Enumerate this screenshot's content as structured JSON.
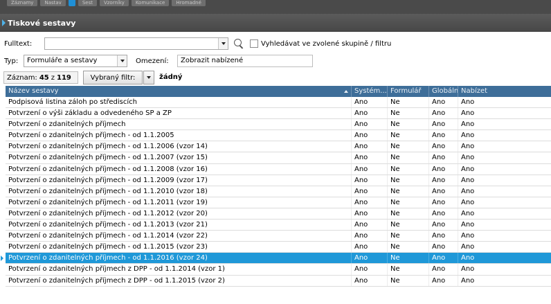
{
  "top_tabs": [
    "Záznamy",
    "Nastav",
    "",
    "Sest",
    "Vzorníky",
    "Komunikace",
    "Hromadné"
  ],
  "window": {
    "title": "Tiskové sestavy"
  },
  "search": {
    "fulltext_label": "Fulltext:",
    "fulltext_value": "",
    "scope_label": "Vyhledávat ve zvolené skupině / filtru"
  },
  "filters": {
    "type_label": "Typ:",
    "type_value": "Formuláře a sestavy",
    "limit_label": "Omezení:",
    "limit_value": "Zobrazit nabízené"
  },
  "status": {
    "records_label": "Záznam:",
    "current": "45",
    "of": "z",
    "total": "119",
    "filter_button": "Vybraný filtr:",
    "filter_value": "žádný"
  },
  "table": {
    "columns": [
      "Název sestavy",
      "Systém...",
      "Formulář",
      "Globální",
      "Nabízet"
    ],
    "rows": [
      [
        "Podpisová listina záloh po střediscích",
        "Ano",
        "Ne",
        "Ano",
        "Ano"
      ],
      [
        "Potvrzení o výši základu a odvedeného SP a ZP",
        "Ano",
        "Ne",
        "Ano",
        "Ano"
      ],
      [
        "Potvrzení o zdanitelných příjmech",
        "Ano",
        "Ne",
        "Ano",
        "Ano"
      ],
      [
        "Potvrzení o zdanitelných příjmech - od 1.1.2005",
        "Ano",
        "Ne",
        "Ano",
        "Ano"
      ],
      [
        "Potvrzení o zdanitelných příjmech - od 1.1.2006 (vzor 14)",
        "Ano",
        "Ne",
        "Ano",
        "Ano"
      ],
      [
        "Potvrzení o zdanitelných příjmech - od 1.1.2007 (vzor 15)",
        "Ano",
        "Ne",
        "Ano",
        "Ano"
      ],
      [
        "Potvrzení o zdanitelných příjmech - od 1.1.2008 (vzor 16)",
        "Ano",
        "Ne",
        "Ano",
        "Ano"
      ],
      [
        "Potvrzení o zdanitelných příjmech - od 1.1.2009 (vzor 17)",
        "Ano",
        "Ne",
        "Ano",
        "Ano"
      ],
      [
        "Potvrzení o zdanitelných příjmech - od 1.1.2010 (vzor 18)",
        "Ano",
        "Ne",
        "Ano",
        "Ano"
      ],
      [
        "Potvrzení o zdanitelných příjmech - od 1.1.2011 (vzor 19)",
        "Ano",
        "Ne",
        "Ano",
        "Ano"
      ],
      [
        "Potvrzení o zdanitelných příjmech - od 1.1.2012 (vzor 20)",
        "Ano",
        "Ne",
        "Ano",
        "Ano"
      ],
      [
        "Potvrzení o zdanitelných příjmech - od 1.1.2013 (vzor 21)",
        "Ano",
        "Ne",
        "Ano",
        "Ano"
      ],
      [
        "Potvrzení o zdanitelných příjmech - od 1.1.2014 (vzor 22)",
        "Ano",
        "Ne",
        "Ano",
        "Ano"
      ],
      [
        "Potvrzení o zdanitelných příjmech - od 1.1.2015 (vzor 23)",
        "Ano",
        "Ne",
        "Ano",
        "Ano"
      ],
      [
        "Potvrzení o zdanitelných příjmech - od 1.1.2016 (vzor 24)",
        "Ano",
        "Ne",
        "Ano",
        "Ano"
      ],
      [
        "Potvrzení o zdanitelných příjmech z DPP - od 1.1.2014 (vzor 1)",
        "Ano",
        "Ne",
        "Ano",
        "Ano"
      ],
      [
        "Potvrzení o zdanitelných příjmech z DPP - od 1.1.2015 (vzor 2)",
        "Ano",
        "Ne",
        "Ano",
        "Ano"
      ]
    ],
    "selected_index": 14
  },
  "icons": {
    "search": "search-icon",
    "dropdown": "chevron-down-icon",
    "sort": "sort-ascending-icon"
  },
  "colors": {
    "header_bg": "#3e6e99",
    "selection": "#1f98d8",
    "titlebar": "#4f4f4f"
  }
}
